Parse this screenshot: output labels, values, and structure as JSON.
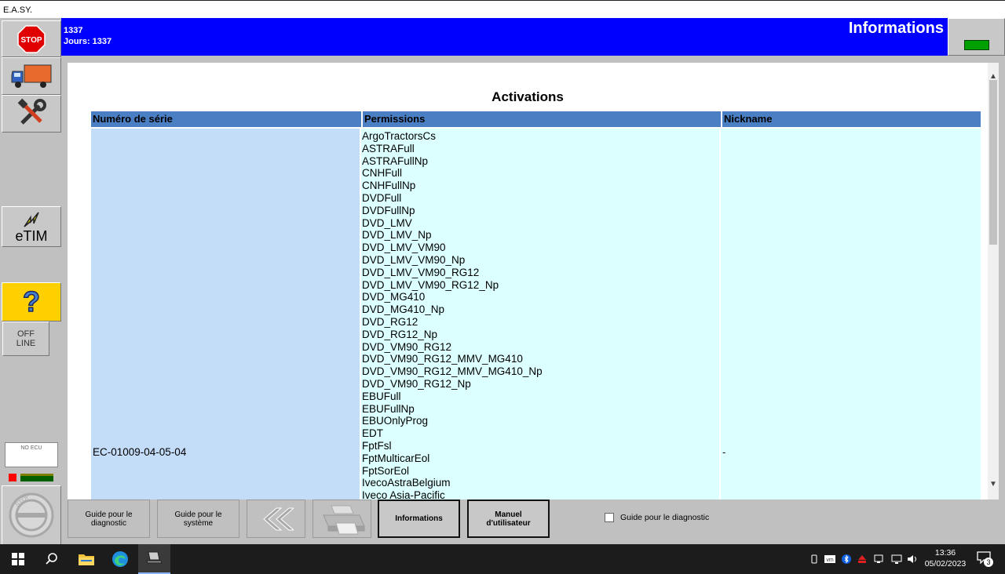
{
  "window": {
    "title": "E.A.SY."
  },
  "sidebar": {
    "stop_label": "STOP",
    "etim_label": "eTIM",
    "help_label": "?",
    "offline_line1": "OFF",
    "offline_line2": "LINE",
    "no_ecu_label": "NO ECU",
    "stop_lower_label": "STOP"
  },
  "header": {
    "line1": "1337",
    "line2": "Jours: 1337",
    "title": "Informations",
    "status_color": "#00a000"
  },
  "content": {
    "title": "Activations",
    "columns": [
      "Numéro de série",
      "Permissions",
      "Nickname"
    ],
    "serial": "EC-01009-04-05-04",
    "nickname": "-",
    "permissions": [
      "ArgoTractorsCs",
      "ASTRAFull",
      "ASTRAFullNp",
      "CNHFull",
      "CNHFullNp",
      "DVDFull",
      "DVDFullNp",
      "DVD_LMV",
      "DVD_LMV_Np",
      "DVD_LMV_VM90",
      "DVD_LMV_VM90_Np",
      "DVD_LMV_VM90_RG12",
      "DVD_LMV_VM90_RG12_Np",
      "DVD_MG410",
      "DVD_MG410_Np",
      "DVD_RG12",
      "DVD_RG12_Np",
      "DVD_VM90_RG12",
      "DVD_VM90_RG12_MMV_MG410",
      "DVD_VM90_RG12_MMV_MG410_Np",
      "DVD_VM90_RG12_Np",
      "EBUFull",
      "EBUFullNp",
      "EBUOnlyProg",
      "EDT",
      "FptFsl",
      "FptMulticarEol",
      "FptSorEol",
      "IvecoAstraBelgium",
      "Iveco Asia-Pacific"
    ]
  },
  "bottom": {
    "guide_diag_l1": "Guide pour le",
    "guide_diag_l2": "diagnostic",
    "guide_sys_l1": "Guide pour le",
    "guide_sys_l2": "système",
    "informations": "Informations",
    "manuel": "Manuel d'utilisateur",
    "checkbox_label": "Guide pour le diagnostic"
  },
  "taskbar": {
    "time": "13:36",
    "date": "05/02/2023",
    "notification_count": "3"
  }
}
